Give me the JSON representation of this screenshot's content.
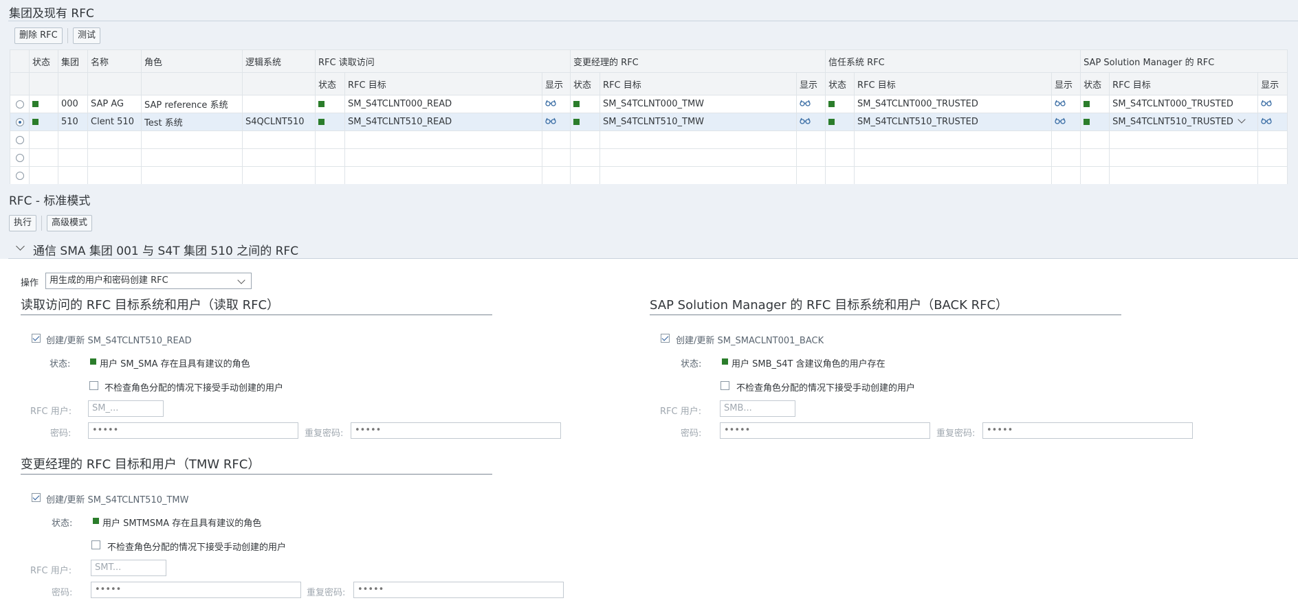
{
  "group_section": {
    "title": "集团及现有 RFC",
    "toolbar": {
      "delete_label": "删除 RFC",
      "test_label": "测试"
    },
    "columns": {
      "status": "状态",
      "client": "集团",
      "name": "名称",
      "role": "角色",
      "logical_system": "逻辑系统",
      "read_group": "RFC 读取访问",
      "tmw_group": "变更经理的 RFC",
      "trusted_group": "信任系统 RFC",
      "solman_group": "SAP Solution Manager 的 RFC",
      "sub_status": "状态",
      "sub_target": "RFC 目标",
      "sub_display": "显示"
    },
    "rows": [
      {
        "client": "000",
        "name": "SAP AG",
        "role": "SAP reference 系统",
        "logical_system": "",
        "read_target": "SM_S4TCLNT000_READ",
        "tmw_target": "SM_S4TCLNT000_TMW",
        "trusted_target": "SM_S4TCLNT000_TRUSTED",
        "solman_target": "SM_S4TCLNT000_TRUSTED",
        "selected": false
      },
      {
        "client": "510",
        "name": "Clent 510",
        "role": "Test 系统",
        "logical_system": "S4QCLNT510",
        "read_target": "SM_S4TCLNT510_READ",
        "tmw_target": "SM_S4TCLNT510_TMW",
        "trusted_target": "SM_S4TCLNT510_TRUSTED",
        "solman_target": "SM_S4TCLNT510_TRUSTED",
        "selected": true
      }
    ],
    "empty_rows": 3
  },
  "rfc_section": {
    "title": "RFC - 标准模式",
    "toolbar": {
      "execute_label": "执行",
      "advanced_label": "高级模式"
    },
    "panel_title": "通信 SMA 集团 001 与 S4T 集团 510 之间的 RFC",
    "operation_label": "操作",
    "operation_value": "用生成的用户和密码创建 RFC",
    "read": {
      "title": "读取访问的 RFC 目标系统和用户（读取 RFC）",
      "create_label": "创建/更新 SM_S4TCLNT510_READ",
      "status_label": "状态:",
      "status_text": "用户 SM_SMA 存在且具有建议的角色",
      "accept_label": "不检查角色分配的情况下接受手动创建的用户",
      "user_label": "RFC 用户:",
      "user_value": "SM_...",
      "password_label": "密码:",
      "password_value": "•••••",
      "repeat_label": "重复密码:",
      "repeat_value": "•••••"
    },
    "back": {
      "title": "SAP Solution Manager 的 RFC 目标系统和用户（BACK RFC）",
      "create_label": "创建/更新 SM_SMACLNT001_BACK",
      "status_label": "状态:",
      "status_text": "用户 SMB_S4T 含建议角色的用户存在",
      "accept_label": "不检查角色分配的情况下接受手动创建的用户",
      "user_label": "RFC 用户:",
      "user_value": "SMB...",
      "password_label": "密码:",
      "password_value": "•••••",
      "repeat_label": "重复密码:",
      "repeat_value": "•••••"
    },
    "tmw": {
      "title": "变更经理的 RFC 目标和用户（TMW RFC）",
      "create_label": "创建/更新 SM_S4TCLNT510_TMW",
      "status_label": "状态:",
      "status_text": "用户 SMTMSMA 存在且具有建议的角色",
      "accept_label": "不检查角色分配的情况下接受手动创建的用户",
      "user_label": "RFC 用户:",
      "user_value": "SMT...",
      "password_label": "密码:",
      "password_value": "•••••",
      "repeat_label": "重复密码:",
      "repeat_value": "•••••"
    }
  }
}
